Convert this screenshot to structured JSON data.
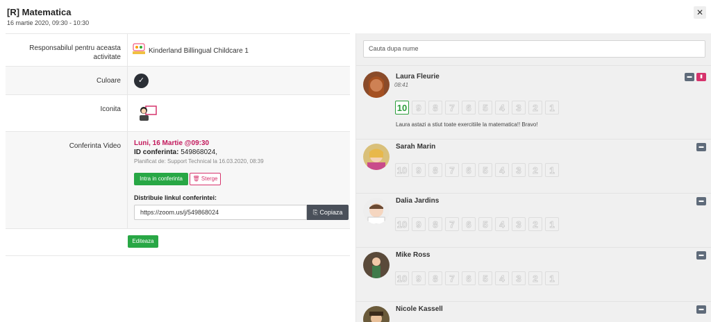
{
  "header": {
    "title": "[R] Matematica",
    "subtitle": "16 martie 2020, 09:30 - 10:30",
    "close": "✕"
  },
  "details": {
    "responsible_label": "Responsabilul pentru aceasta activitate",
    "responsible_name": "Kinderland Billingual Childcare 1",
    "color_label": "Culoare",
    "color_value": "#2b2f36",
    "color_check": "✓",
    "icon_label": "Iconita",
    "video_label": "Conferinta Video",
    "video_date": "Luni, 16 Martie @09:30",
    "video_id_label": "ID conferinta:",
    "video_id": "549868024,",
    "video_planned": "Planificat de: Support Technical la 16.03.2020, 08:39",
    "join_label": "Intra in conferinta",
    "delete_label": "🗑 Sterge",
    "share_label": "Distribuie linkul conferintei:",
    "share_link": "https://zoom.us/j/549868024",
    "copy_label": "⎘ Copiaza",
    "edit_label": "Editeaza"
  },
  "students": {
    "search_placeholder": "Cauta dupa nume",
    "grades": [
      "10",
      "9",
      "8",
      "7",
      "6",
      "5",
      "4",
      "3",
      "2",
      "1"
    ],
    "list": [
      {
        "name": "Laura Fleurie",
        "time": "08:41",
        "selected_grade": "10",
        "comment": "Laura astazi a stiut toate exercitiile la matematica!! Bravo!"
      },
      {
        "name": "Sarah Marin"
      },
      {
        "name": "Dalia Jardins"
      },
      {
        "name": "Mike Ross"
      },
      {
        "name": "Nicole Kassell"
      }
    ]
  },
  "colors": {
    "accent_green": "#28a745",
    "accent_pink": "#d6336c"
  }
}
